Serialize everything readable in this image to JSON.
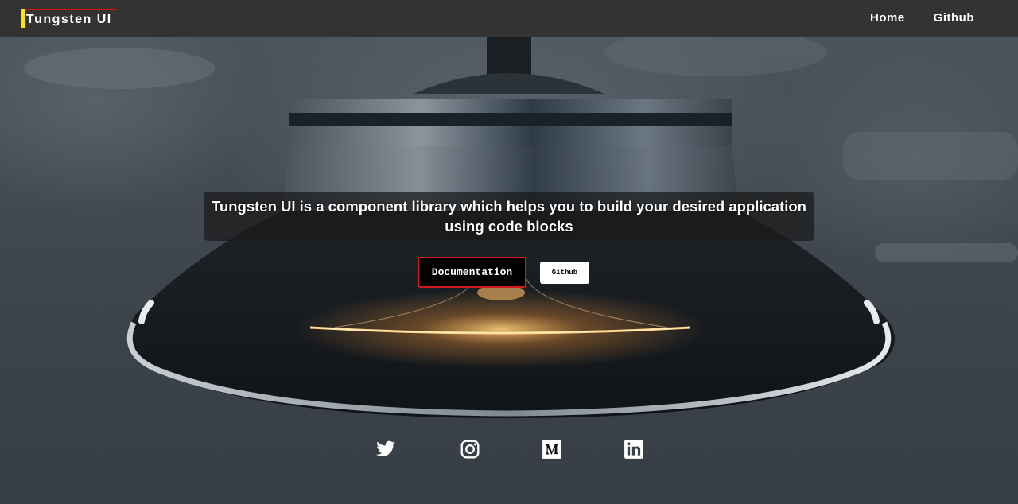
{
  "navbar": {
    "brand": "Tungsten UI",
    "links": [
      {
        "label": "Home"
      },
      {
        "label": "Github"
      }
    ]
  },
  "hero": {
    "headline": "Tungsten UI is a component library which helps you to build your desired application using code blocks",
    "primary_button": "Documentation",
    "secondary_button": "Github"
  },
  "socials": [
    {
      "icon": "twitter-icon"
    },
    {
      "icon": "instagram-icon"
    },
    {
      "icon": "medium-icon"
    },
    {
      "icon": "linkedin-icon"
    }
  ],
  "colors": {
    "navbar_bg": "#333333",
    "brand_accent_yellow": "#ffe500",
    "brand_accent_red": "#d21414",
    "button_border": "#d11a1a",
    "filament_glow": "#ffb347"
  }
}
